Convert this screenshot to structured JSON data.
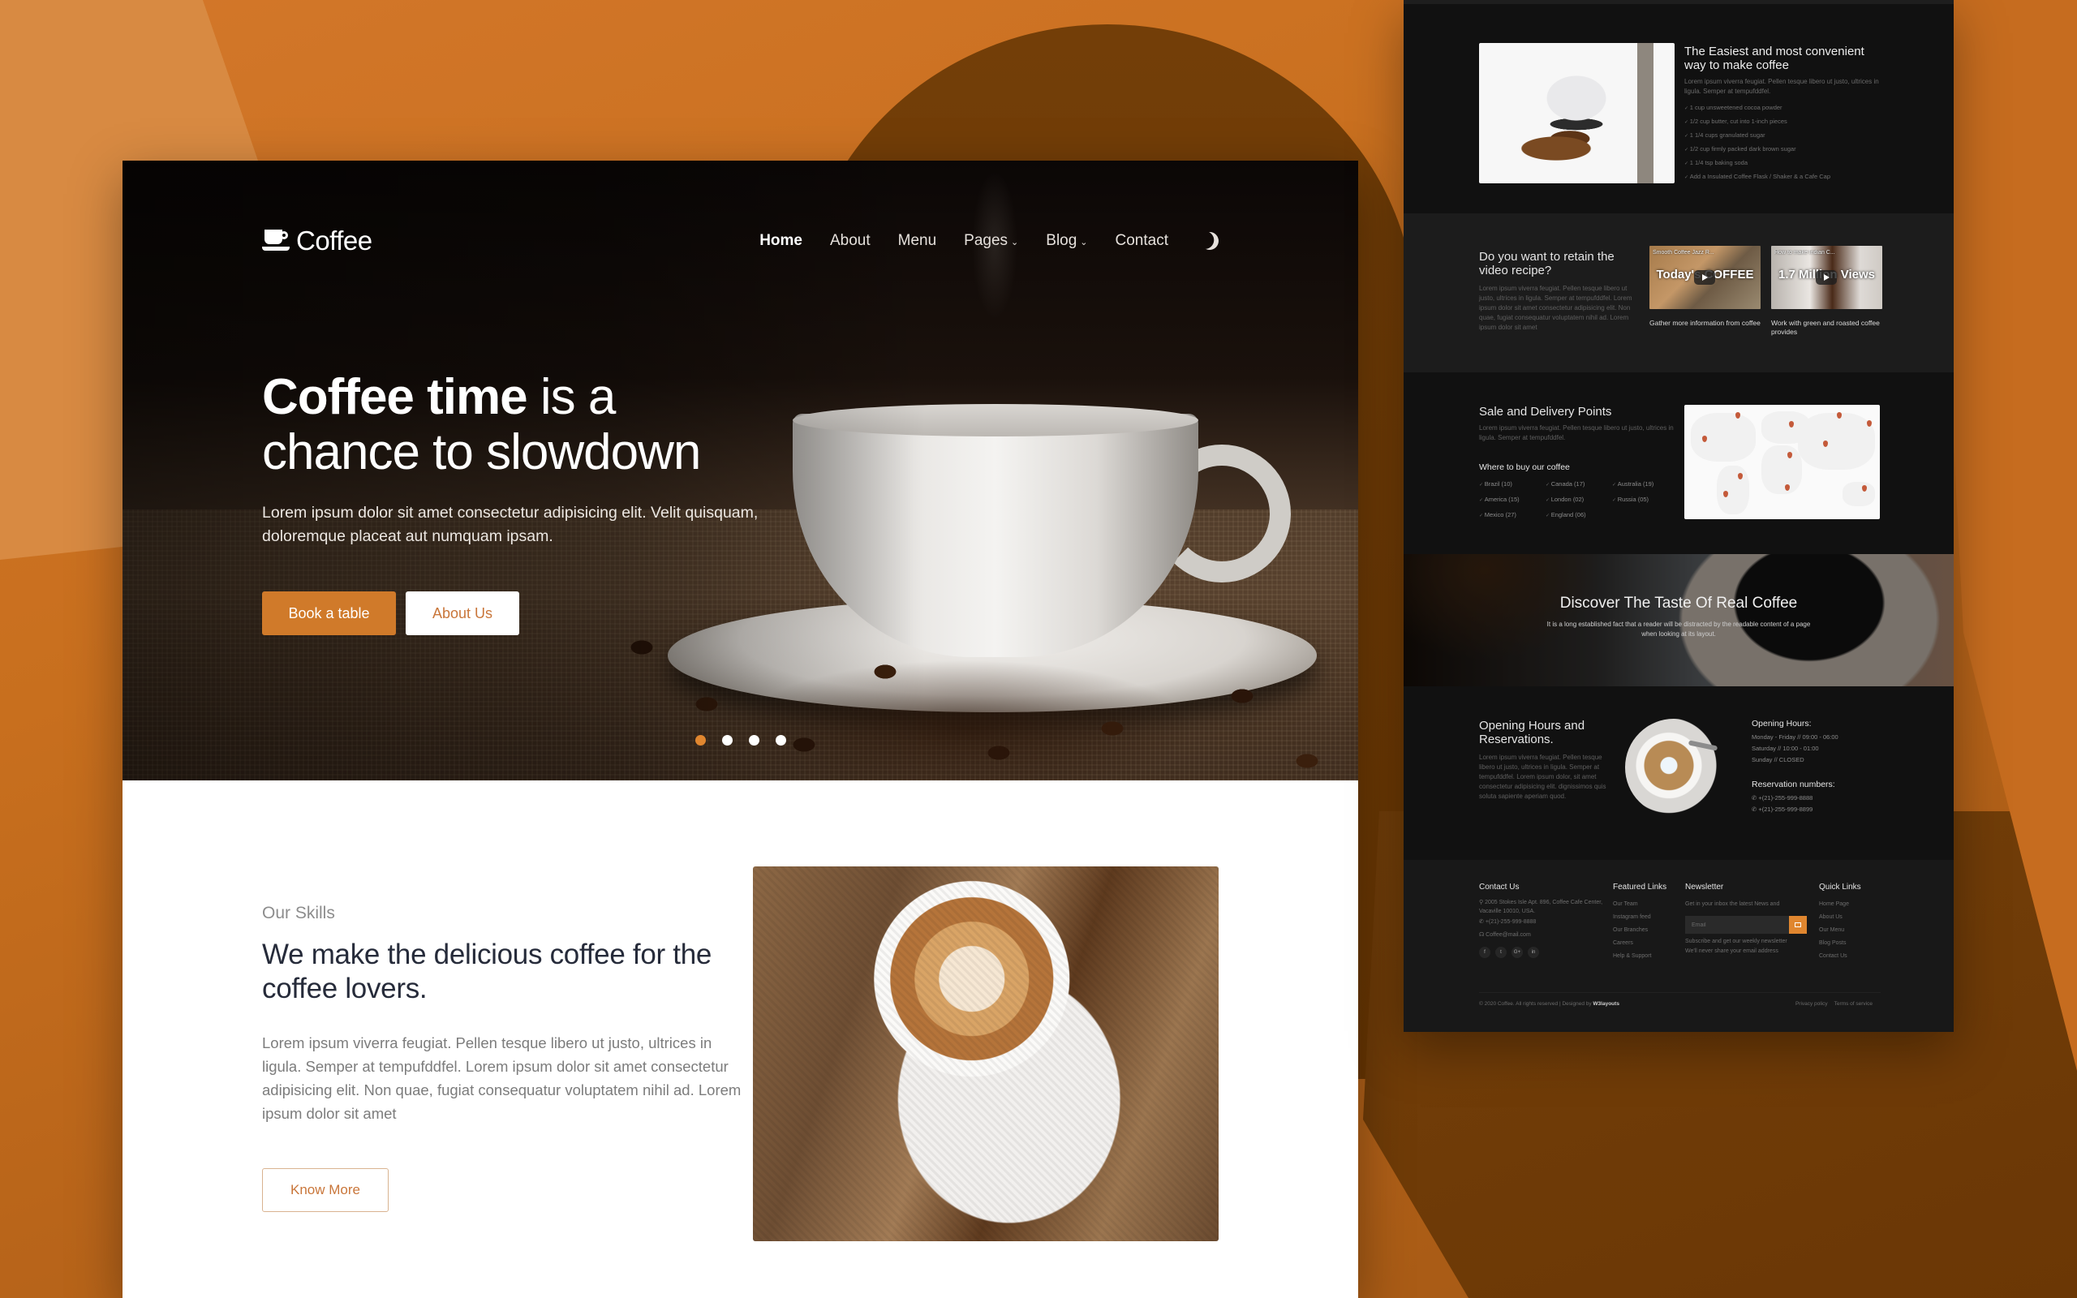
{
  "theme": {
    "accent": "#d07a2a",
    "dot_active": "#e0862f",
    "background": "#cf7621"
  },
  "brand": {
    "name": "Coffee",
    "icon": "coffee-cup-icon"
  },
  "nav": {
    "items": [
      {
        "label": "Home",
        "active": true
      },
      {
        "label": "About"
      },
      {
        "label": "Menu"
      },
      {
        "label": "Pages",
        "dropdown": true
      },
      {
        "label": "Blog",
        "dropdown": true
      },
      {
        "label": "Contact"
      }
    ],
    "theme_toggle_icon": "moon-icon",
    "dropdown_glyph": "⌄"
  },
  "hero": {
    "title_bold": "Coffee time",
    "title_rest_line1": " is a",
    "title_line2": "chance to slowdown",
    "description": "Lorem ipsum dolor sit amet consectetur adipisicing elit. Velit quisquam, doloremque placeat aut numquam ipsam.",
    "primary_button": "Book a table",
    "secondary_button": "About Us",
    "slides_total": 4,
    "slide_active": 1
  },
  "skills": {
    "eyebrow": "Our Skills",
    "title": "We make the delicious coffee for the coffee lovers.",
    "description": "Lorem ipsum viverra feugiat. Pellen tesque libero ut justo, ultrices in ligula. Semper at tempufddfel. Lorem ipsum dolor sit amet consectetur adipisicing elit. Non quae, fugiat consequatur voluptatem nihil ad. Lorem ipsum dolor sit amet",
    "button": "Know More"
  },
  "recipe": {
    "title": "The Easiest and most convenient way to make coffee",
    "description": "Lorem ipsum viverra feugiat. Pellen tesque libero ut justo, ultrices in ligula. Semper at tempufddfel.",
    "items": [
      "1 cup unsweetened cocoa powder",
      "1/2 cup butter, cut into 1-inch pieces",
      "1 1/4 cups granulated sugar",
      "1/2 cup firmly packed dark brown sugar",
      "1 1/4 tsp baking soda",
      "Add a Insulated Coffee Flask / Shaker & a Cafe Cap"
    ]
  },
  "video": {
    "title": "Do you want to retain the video recipe?",
    "description": "Lorem ipsum viverra feugiat. Pellen tesque libero ut justo, ultrices in ligula. Semper at tempufddfel. Lorem ipsum dolor sit amet consectetur adipisicing elit. Non quae, fugiat consequatur voluptatem nihil ad. Lorem ipsum dolor sit amet",
    "cards": [
      {
        "thumb_title": "Smooth Coffee Jazz R...",
        "thumb_text": "Today's COFFEE",
        "caption": "Gather more information from coffee"
      },
      {
        "thumb_title": "How to make Indian C...",
        "thumb_text": "1.7 Million Views",
        "caption": "Work with green and roasted coffee provides"
      }
    ]
  },
  "delivery": {
    "title": "Sale and Delivery Points",
    "description": "Lorem ipsum viverra feugiat. Pellen tesque libero ut justo, ultrices in ligula. Semper at tempufddfel.",
    "subtitle": "Where to buy our coffee",
    "countries": [
      "Brazil (10)",
      "Canada (17)",
      "Australia (19)",
      "America (15)",
      "London (02)",
      "Russia (05)",
      "Mexico (27)",
      "England (06)"
    ],
    "map_pin_count": 11
  },
  "discover": {
    "title": "Discover The Taste Of Real Coffee",
    "description": "It is a long established fact that a reader will be distracted by the readable content of a page when looking at its layout."
  },
  "hours": {
    "title": "Opening Hours and Reservations.",
    "description": "Lorem ipsum viverra feugiat. Pellen tesque libero ut justo, ultrices in ligula. Semper at tempufddfel. Lorem ipsum dolor, sit amet consectetur adipisicing elit. dignissimos quis soluta sapiente aperiam quod.",
    "opening_title": "Opening Hours:",
    "opening_lines": [
      "Monday - Friday // 09:00 - 06:00",
      "Saturday // 10:00 - 01:00",
      "Sunday // CLOSED"
    ],
    "reservation_title": "Reservation numbers:",
    "phones": [
      "+(21)-255-999-8888",
      "+(21)-255-999-8899"
    ]
  },
  "footer": {
    "contact": {
      "title": "Contact Us",
      "address": "2005 Stokes Isle Apt. 896, Coffee Cafe Center, Vacaville 10010, USA.",
      "phone": "+(21)-255-999-8888",
      "email": "Coffee@mail.com",
      "socials": [
        "f",
        "t",
        "G+",
        "in"
      ]
    },
    "featured": {
      "title": "Featured Links",
      "links": [
        "Our Team",
        "Instagram feed",
        "Our Branches",
        "Careers",
        "Help & Support"
      ]
    },
    "newsletter": {
      "title": "Newsletter",
      "intro": "Get in your inbox the latest News and",
      "placeholder": "Email",
      "note1": "Subscribe and get our weekly newsletter",
      "note2": "We'll never share your email address"
    },
    "quick": {
      "title": "Quick Links",
      "links": [
        "Home Page",
        "About Us",
        "Our Menu",
        "Blog Posts",
        "Contact Us"
      ]
    },
    "copyright": "© 2020 Coffee. All rights reserved | Designed by ",
    "designer": "W3layouts",
    "legal": [
      "Privacy policy",
      "Terms of service"
    ]
  }
}
